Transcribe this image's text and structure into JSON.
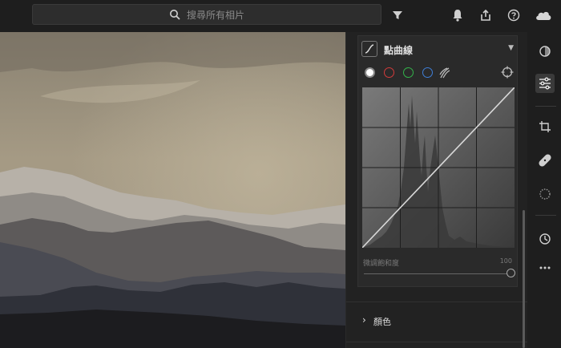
{
  "search": {
    "placeholder": "搜尋所有相片"
  },
  "panel": {
    "curve": {
      "title": "點曲線",
      "saturation_label": "微調飽和度",
      "saturation_value": "100",
      "channels": [
        "rgb",
        "red",
        "green",
        "blue",
        "refine"
      ]
    },
    "color_section": {
      "label": "顏色"
    }
  },
  "colors": {
    "accent_red": "#d33b3b",
    "accent_green": "#33b24a",
    "accent_blue": "#3f7fd8"
  },
  "icons": {
    "topbar": [
      "search-icon",
      "filter-icon",
      "bell-icon",
      "share-icon",
      "help-icon",
      "cloud-icon"
    ],
    "toolbar": [
      "presets-icon",
      "edit-sliders-icon",
      "crop-icon",
      "healing-icon",
      "masking-icon",
      "history-icon",
      "more-icon"
    ]
  }
}
